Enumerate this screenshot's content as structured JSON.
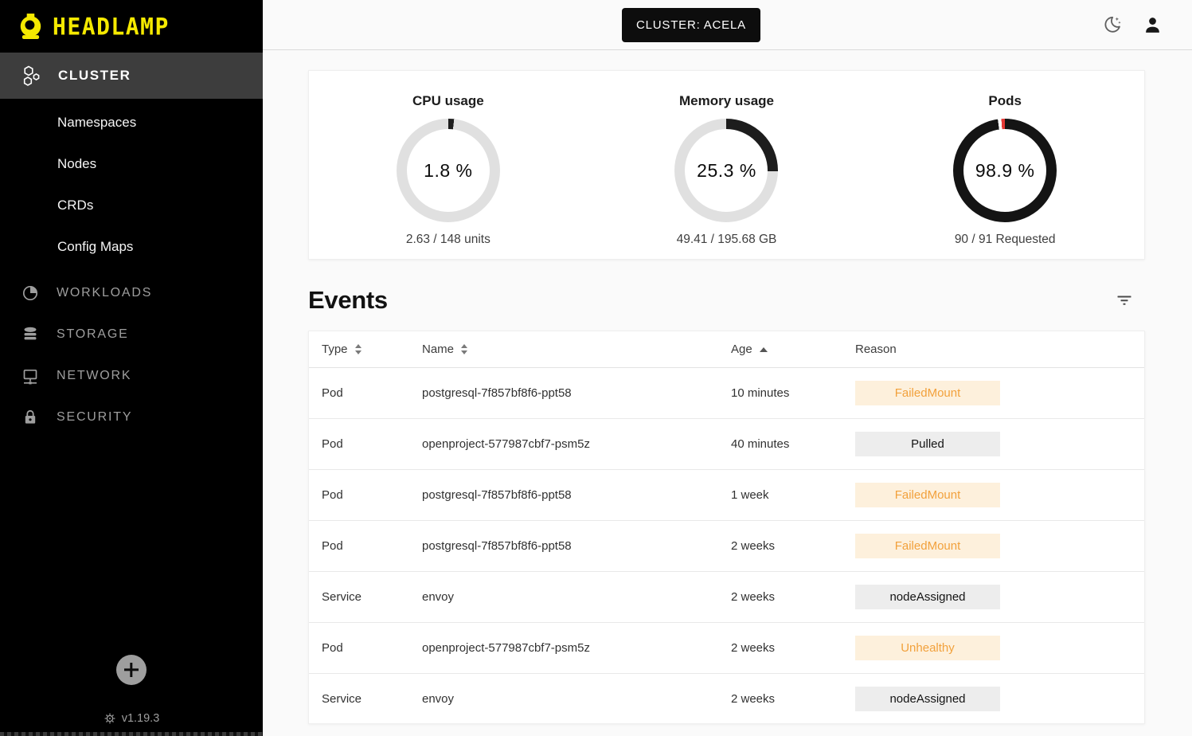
{
  "brand": {
    "logo_text": "HEADLAMP",
    "accent_yellow": "#f5e900"
  },
  "topbar": {
    "cluster_chip": "CLUSTER: ACELA",
    "dark_mode_icon": "moon-icon",
    "account_icon": "person-icon"
  },
  "sidebar": {
    "primary": {
      "label": "CLUSTER",
      "icon": "cluster-hexagons-icon",
      "selected": true
    },
    "children": [
      "Namespaces",
      "Nodes",
      "CRDs",
      "Config Maps"
    ],
    "sections": [
      {
        "label": "WORKLOADS",
        "icon": "pie-chart-icon"
      },
      {
        "label": "STORAGE",
        "icon": "database-icon"
      },
      {
        "label": "NETWORK",
        "icon": "network-icon"
      },
      {
        "label": "SECURITY",
        "icon": "lock-icon"
      }
    ],
    "add_button_icon": "plus-icon",
    "version": "v1.19.3",
    "version_icon": "wheel-icon"
  },
  "overview_charts": [
    {
      "title": "CPU usage",
      "center_label": "1.8 %",
      "percent": 1.8,
      "legend": "2.63 / 148 units",
      "segments": [
        {
          "color": "#1d1d1d",
          "from": 0,
          "to": 1.8
        },
        {
          "color": "#e0e0e0",
          "from": 1.8,
          "to": 100
        }
      ]
    },
    {
      "title": "Memory usage",
      "center_label": "25.3 %",
      "percent": 25.3,
      "legend": "49.41 / 195.68 GB",
      "segments": [
        {
          "color": "#1d1d1d",
          "from": 0,
          "to": 25.3
        },
        {
          "color": "#e0e0e0",
          "from": 25.3,
          "to": 100
        }
      ]
    },
    {
      "title": "Pods",
      "center_label": "98.9 %",
      "percent": 98.9,
      "legend": "90 / 91 Requested",
      "segments": [
        {
          "color": "#141414",
          "from": 0,
          "to": 97.8
        },
        {
          "color": "#ffffff",
          "from": 97.8,
          "to": 98.9
        },
        {
          "color": "#e53935",
          "from": 98.9,
          "to": 100
        }
      ]
    }
  ],
  "events": {
    "title": "Events",
    "filter_icon": "filter-icon",
    "columns": [
      {
        "label": "Type",
        "sort": "both"
      },
      {
        "label": "Name",
        "sort": "both"
      },
      {
        "label": "Age",
        "sort": "asc"
      },
      {
        "label": "Reason",
        "sort": "none"
      }
    ],
    "rows": [
      {
        "type": "Pod",
        "name": "postgresql-7f857bf8f6-ppt58",
        "age": "10 minutes",
        "reason": "FailedMount",
        "reason_kind": "warning"
      },
      {
        "type": "Pod",
        "name": "openproject-577987cbf7-psm5z",
        "age": "40 minutes",
        "reason": "Pulled",
        "reason_kind": "normal"
      },
      {
        "type": "Pod",
        "name": "postgresql-7f857bf8f6-ppt58",
        "age": "1 week",
        "reason": "FailedMount",
        "reason_kind": "warning"
      },
      {
        "type": "Pod",
        "name": "postgresql-7f857bf8f6-ppt58",
        "age": "2 weeks",
        "reason": "FailedMount",
        "reason_kind": "warning"
      },
      {
        "type": "Service",
        "name": "envoy",
        "age": "2 weeks",
        "reason": "nodeAssigned",
        "reason_kind": "normal"
      },
      {
        "type": "Pod",
        "name": "openproject-577987cbf7-psm5z",
        "age": "2 weeks",
        "reason": "Unhealthy",
        "reason_kind": "warning"
      },
      {
        "type": "Service",
        "name": "envoy",
        "age": "2 weeks",
        "reason": "nodeAssigned",
        "reason_kind": "normal"
      }
    ],
    "badge_colors": {
      "warning_bg": "#fdf0dc",
      "warning_text": "#f2a13c",
      "normal_bg": "#ededed",
      "normal_text": "#141414"
    }
  }
}
